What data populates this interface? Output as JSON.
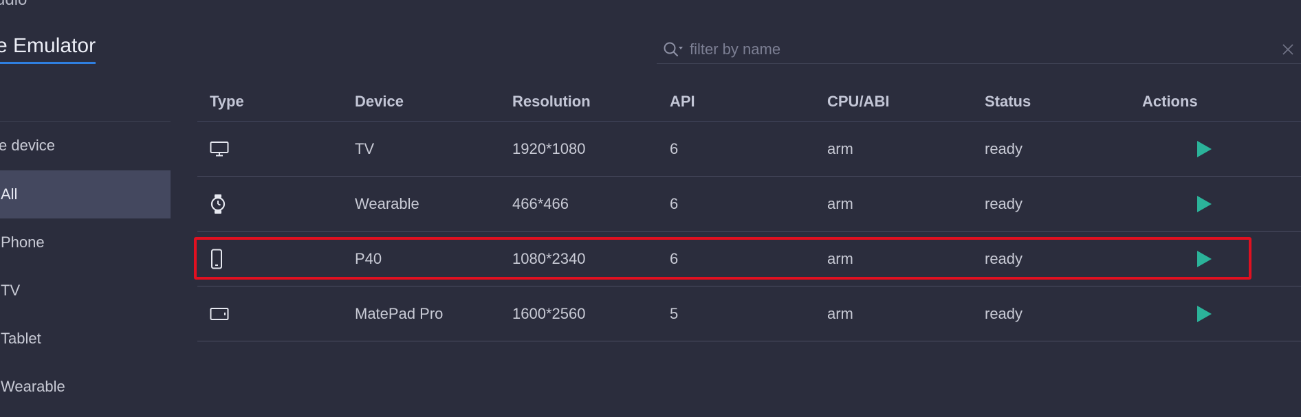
{
  "header": {
    "top_cut_text": "udio",
    "app_title": "e Emulator"
  },
  "sidebar": {
    "heading": "e device",
    "items": [
      {
        "label": "All",
        "active": true
      },
      {
        "label": "Phone",
        "active": false
      },
      {
        "label": "TV",
        "active": false
      },
      {
        "label": "Tablet",
        "active": false
      },
      {
        "label": "Wearable",
        "active": false
      }
    ]
  },
  "search": {
    "placeholder": "filter by name",
    "value": "",
    "icon": "search-icon",
    "clear_icon": "close-icon"
  },
  "table": {
    "columns": [
      "Type",
      "Device",
      "Resolution",
      "API",
      "CPU/ABI",
      "Status",
      "Actions"
    ],
    "rows": [
      {
        "type_icon": "tv-icon",
        "device": "TV",
        "resolution": "1920*1080",
        "api": "6",
        "cpu": "arm",
        "status": "ready",
        "action_icon": "play-icon"
      },
      {
        "type_icon": "watch-icon",
        "device": "Wearable",
        "resolution": "466*466",
        "api": "6",
        "cpu": "arm",
        "status": "ready",
        "action_icon": "play-icon"
      },
      {
        "type_icon": "phone-icon",
        "device": "P40",
        "resolution": "1080*2340",
        "api": "6",
        "cpu": "arm",
        "status": "ready",
        "action_icon": "play-icon",
        "highlighted": true
      },
      {
        "type_icon": "tablet-icon",
        "device": "MatePad Pro",
        "resolution": "1600*2560",
        "api": "5",
        "cpu": "arm",
        "status": "ready",
        "action_icon": "play-icon"
      }
    ]
  },
  "colors": {
    "background": "#2b2d3d",
    "accent_blue": "#2f7fe0",
    "play_green": "#2bb39a",
    "highlight_red": "#e01020",
    "sidebar_active": "#44485f"
  }
}
